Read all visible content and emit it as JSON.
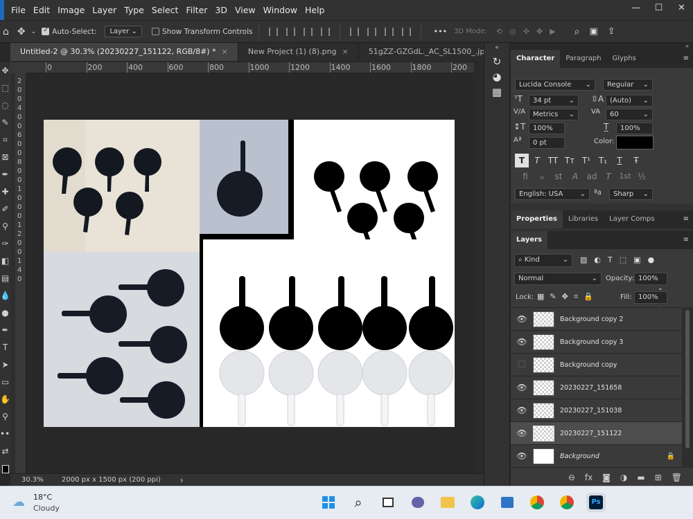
{
  "menu": [
    "File",
    "Edit",
    "Image",
    "Layer",
    "Type",
    "Select",
    "Filter",
    "3D",
    "View",
    "Window",
    "Help"
  ],
  "window_controls": {
    "minimize": "—",
    "maximize": "☐",
    "close": "✕"
  },
  "options_bar": {
    "auto_select_label": "Auto-Select:",
    "auto_select_value": "Layer",
    "show_transform_label": "Show Transform Controls",
    "more": "•••",
    "mode_3d": "3D Mode:"
  },
  "tabs": [
    {
      "title": "Untitled-2 @ 30.3% (20230227_151122, RGB/8#) *",
      "close": "×"
    },
    {
      "title": "New Project (1) (8).png",
      "close": "×"
    },
    {
      "title": "51gZZ-GZGdL._AC_SL1500_.jpg",
      "close": "×"
    }
  ],
  "tab_overflow": "»",
  "ruler_h": [
    "0",
    "200",
    "400",
    "600",
    "800",
    "1000",
    "1200",
    "1400",
    "1600",
    "1800",
    "200"
  ],
  "ruler_v": [
    "2",
    "0",
    "0",
    "4",
    "0",
    "0",
    "6",
    "0",
    "0",
    "8",
    "0",
    "0",
    "1",
    "0",
    "0",
    "0",
    "1",
    "2",
    "0",
    "0",
    "1",
    "4",
    "0"
  ],
  "status": {
    "zoom": "30.3%",
    "doc_info": "2000 px x 1500 px (200 ppi)",
    "arrow": "›"
  },
  "character_panel": {
    "tabs": [
      "Character",
      "Paragraph",
      "Glyphs"
    ],
    "font_family": "Lucida Console",
    "font_style": "Regular",
    "size": "34 pt",
    "leading": "(Auto)",
    "kerning": "Metrics",
    "tracking": "60",
    "vscale": "100%",
    "hscale": "100%",
    "baseline": "0 pt",
    "color_label": "Color:",
    "color_value": "#000000",
    "style_buttons": [
      "T",
      "T",
      "TT",
      "Tт",
      "T¹",
      "T₁",
      "T",
      "Ŧ"
    ],
    "ot_buttons": [
      "fi",
      "ℴ",
      "st",
      "A",
      "ad",
      "T",
      "1st",
      "½"
    ],
    "language": "English: USA",
    "aa_label": "ªa",
    "antialias": "Sharp"
  },
  "props_tabs": [
    "Properties",
    "Libraries",
    "Layer Comps"
  ],
  "layers_panel": {
    "tab": "Layers",
    "kind": "Kind",
    "blend": "Normal",
    "opacity_label": "Opacity:",
    "opacity": "100%",
    "lock_label": "Lock:",
    "fill_label": "Fill:",
    "fill": "100%",
    "layers": [
      {
        "name": "Background copy 2",
        "visible": true,
        "selected": false
      },
      {
        "name": "Background copy 3",
        "visible": true,
        "selected": false
      },
      {
        "name": "Background copy",
        "visible": false,
        "selected": false
      },
      {
        "name": "20230227_151658",
        "visible": true,
        "selected": false
      },
      {
        "name": "20230227_151038",
        "visible": true,
        "selected": false
      },
      {
        "name": "20230227_151122",
        "visible": true,
        "selected": true
      },
      {
        "name": "Background",
        "visible": true,
        "selected": false
      }
    ],
    "footer_icons": [
      "link-icon",
      "fx-icon",
      "mask-icon",
      "adjustment-icon",
      "group-icon",
      "new-layer-icon",
      "trash-icon"
    ]
  },
  "taskbar": {
    "temp": "18°C",
    "weather": "Cloudy"
  },
  "colors": {
    "accent": "#1d6bb7",
    "panel_bg": "#323232",
    "canvas_bg": "#282828",
    "ps_blue": "#31a8ff"
  }
}
